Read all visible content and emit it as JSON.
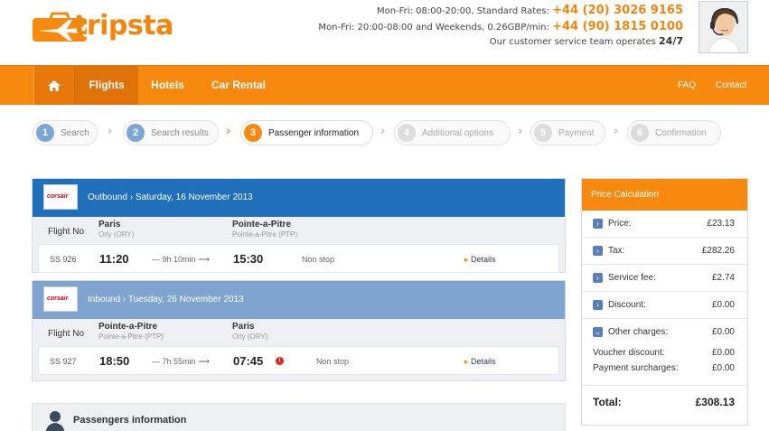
{
  "header": {
    "logo_text": "tripsta",
    "logo_reg": "®",
    "line1_text": "Mon-Fri: 08:00-20:00, Standard Rates:",
    "line1_phone": "+44 (20) 3026 9165",
    "line2_text": "Mon-Fri: 20:00-08:00 and Weekends, 0.26GBP/min:",
    "line2_phone": "+44 (90) 1815 0100",
    "line3_text": "Our customer service team operates",
    "line3_bold": "24/7"
  },
  "nav": {
    "items": [
      {
        "label": "Flights"
      },
      {
        "label": "Hotels"
      },
      {
        "label": "Car Rental"
      }
    ],
    "faq": "FAQ",
    "contact": "Contact"
  },
  "steps": [
    {
      "num": "1",
      "label": "Search"
    },
    {
      "num": "2",
      "label": "Search results"
    },
    {
      "num": "3",
      "label": "Passenger information"
    },
    {
      "num": "4",
      "label": "Additional options"
    },
    {
      "num": "5",
      "label": "Payment"
    },
    {
      "num": "6",
      "label": "Confirmation"
    }
  ],
  "outbound": {
    "carrier": "corsair",
    "title": "Outbound › Saturday, 16 November 2013",
    "col_label": "Flight No",
    "from_city": "Paris",
    "from_airport": "Orly (ORY)",
    "to_city": "Pointe-a-Pitre",
    "to_airport": "Pointe-a-Pitre (PTP)",
    "flight_no": "SS 926",
    "dep": "11:20",
    "duration": "— 9h 10min ⟶",
    "arr": "15:30",
    "stops": "Non stop",
    "details": "Details"
  },
  "inbound": {
    "carrier": "corsair",
    "title": "Inbound › Tuesday, 26 November 2013",
    "col_label": "Flight No",
    "from_city": "Pointe-a-Pitre",
    "from_airport": "Pointe-a-Pitre (PTP)",
    "to_city": "Paris",
    "to_airport": "Orly (ORY)",
    "flight_no": "SS 927",
    "dep": "18:50",
    "duration": "— 7h 55min ⟶",
    "arr": "07:45",
    "warn": "!",
    "stops": "Non stop",
    "details": "Details"
  },
  "passengers": {
    "title": "Passengers information"
  },
  "price": {
    "title": "Price Calculation",
    "rows": [
      {
        "label": "Price:",
        "value": "£23.13"
      },
      {
        "label": "Tax:",
        "value": "£282.26"
      },
      {
        "label": "Service fee:",
        "value": "£2.74"
      },
      {
        "label": "Discount:",
        "value": "£0.00"
      },
      {
        "label": "Other charges:",
        "value": "£0.00"
      }
    ],
    "voucher_label": "Voucher discount:",
    "voucher_value": "£0.00",
    "surcharge_label": "Payment surcharges:",
    "surcharge_value": "£0.00",
    "total_label": "Total:",
    "total_value": "£308.13"
  },
  "colors": {
    "brand_orange": "#f7890f",
    "outbound_blue": "#1f6fbb",
    "inbound_blue": "#7fa4cf"
  }
}
